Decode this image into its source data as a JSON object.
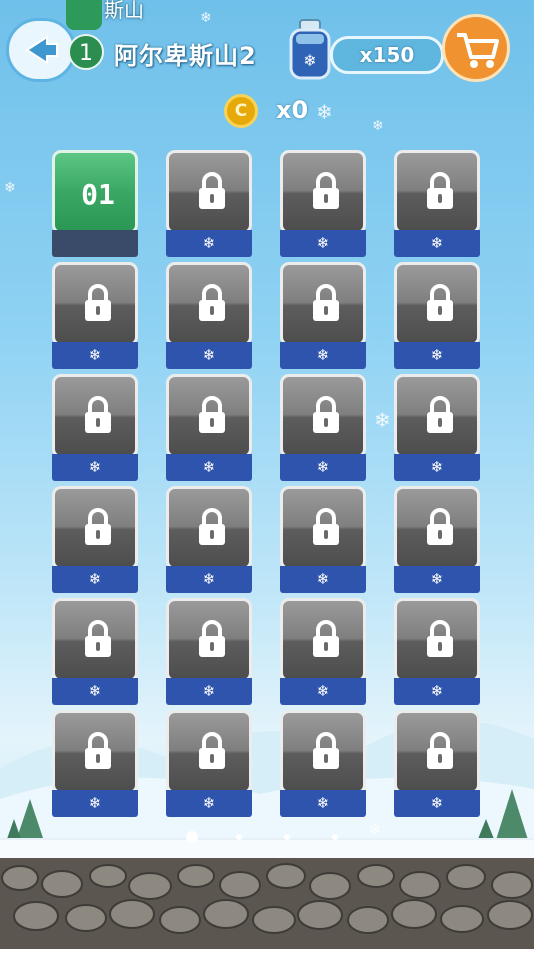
{
  "header": {
    "category_title": "斯山",
    "level_number": "1",
    "level_title": "阿尔卑斯山2",
    "jar_count": "x150",
    "coin_count": "x0",
    "coin_symbol": "C"
  },
  "colors": {
    "unlocked_tile": "#3aa864",
    "locked_tile": "#7f7f7f",
    "tile_base": "#2f54ad",
    "cart_button": "#f0922f"
  },
  "icons": {
    "back": "back-arrow-icon",
    "jar": "snowflake-jar-icon",
    "cart": "shopping-cart-icon",
    "coin": "coin-icon",
    "lock": "lock-icon",
    "base": "snowflake-icon"
  },
  "levels": [
    {
      "label": "01",
      "locked": false
    },
    {
      "label": "",
      "locked": true
    },
    {
      "label": "",
      "locked": true
    },
    {
      "label": "",
      "locked": true
    },
    {
      "label": "",
      "locked": true
    },
    {
      "label": "",
      "locked": true
    },
    {
      "label": "",
      "locked": true
    },
    {
      "label": "",
      "locked": true
    },
    {
      "label": "",
      "locked": true
    },
    {
      "label": "",
      "locked": true
    },
    {
      "label": "",
      "locked": true
    },
    {
      "label": "",
      "locked": true
    },
    {
      "label": "",
      "locked": true
    },
    {
      "label": "",
      "locked": true
    },
    {
      "label": "",
      "locked": true
    },
    {
      "label": "",
      "locked": true
    },
    {
      "label": "",
      "locked": true
    },
    {
      "label": "",
      "locked": true
    },
    {
      "label": "",
      "locked": true
    },
    {
      "label": "",
      "locked": true
    },
    {
      "label": "",
      "locked": true
    },
    {
      "label": "",
      "locked": true
    },
    {
      "label": "",
      "locked": true
    },
    {
      "label": "",
      "locked": true
    }
  ],
  "base_symbol": "❄",
  "page_indicator": {
    "total": 4,
    "active": 0
  }
}
